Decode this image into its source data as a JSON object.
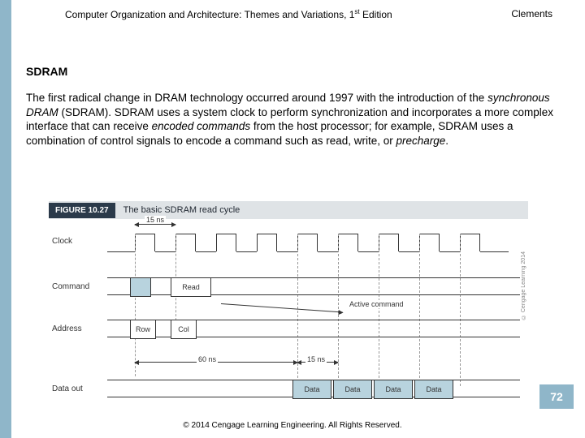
{
  "header": {
    "book_title": "Computer Organization and Architecture: Themes and Variations, 1",
    "edition_suffix": "st",
    "edition_word": " Edition",
    "author": "Clements"
  },
  "section_title": "SDRAM",
  "body": {
    "p1_a": "The first radical change in DRAM technology occurred around 1997 with the introduction of the ",
    "p1_i1": "synchronous DRAM",
    "p1_b": " (SDRAM).  SDRAM uses a system clock to perform synchronization and incorporates a more complex interface that can receive ",
    "p1_i2": "encoded commands",
    "p1_c": " from the host processor; for example, SDRAM uses a combination of control signals to encode a command such as read, write, or ",
    "p1_i3": "precharge",
    "p1_d": "."
  },
  "figure": {
    "number": "FIGURE 10.27",
    "caption": "The basic SDRAM read cycle",
    "rows": {
      "clock": "Clock",
      "command": "Command",
      "address": "Address",
      "data_out": "Data out"
    },
    "labels": {
      "t15": "15 ns",
      "t60": "60 ns",
      "read": "Read",
      "active": "Active command",
      "row": "Row",
      "col": "Col",
      "data": "Data"
    },
    "side_copyright": "© Cengage Learning 2014"
  },
  "page_number": "72",
  "footer": "© 2014 Cengage Learning Engineering. All Rights Reserved."
}
